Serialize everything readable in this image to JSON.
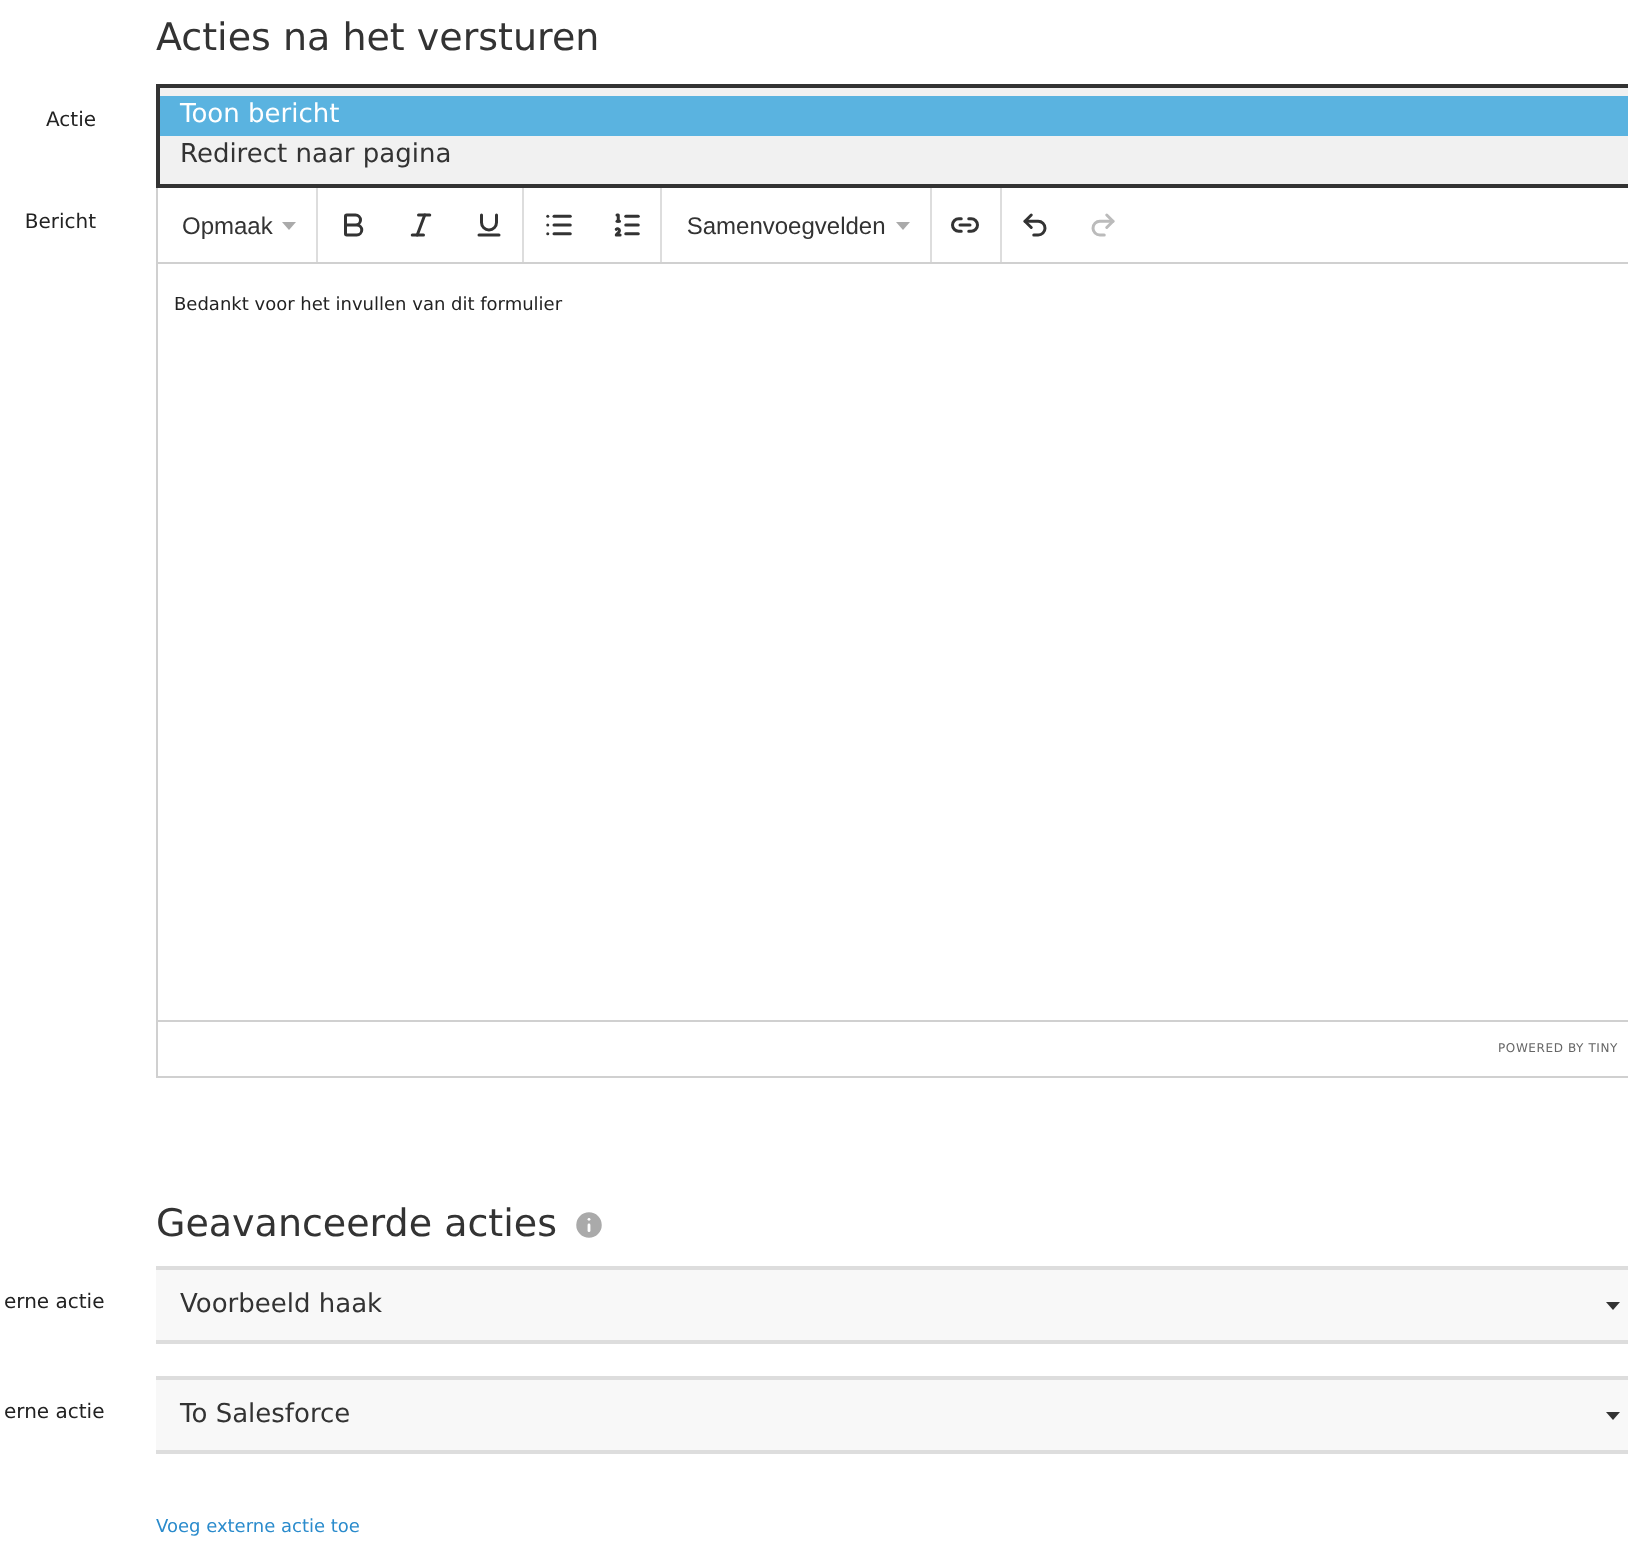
{
  "section_title": "Acties na het versturen",
  "action_field": {
    "label": "Actie",
    "options": [
      {
        "label": "Toon bericht",
        "selected": true
      },
      {
        "label": "Redirect naar pagina",
        "selected": false
      }
    ]
  },
  "message_field": {
    "label": "Bericht",
    "toolbar": [
      {
        "kind": "dropdown",
        "label": "Opmaak"
      },
      {
        "kind": "separator"
      },
      {
        "kind": "bold",
        "disabled": false
      },
      {
        "kind": "italic",
        "disabled": false
      },
      {
        "kind": "underline",
        "disabled": false
      },
      {
        "kind": "separator"
      },
      {
        "kind": "bullets",
        "disabled": false
      },
      {
        "kind": "numbering",
        "disabled": false
      },
      {
        "kind": "separator"
      },
      {
        "kind": "dropdown",
        "label": "Samenvoegvelden"
      },
      {
        "kind": "separator"
      },
      {
        "kind": "link",
        "disabled": false
      },
      {
        "kind": "separator"
      },
      {
        "kind": "undo",
        "disabled": false
      },
      {
        "kind": "redo",
        "disabled": true
      }
    ],
    "content": "Bedankt voor het invullen van dit formulier",
    "branding": "POWERED BY TINY"
  },
  "advanced_title": "Geavanceerde acties",
  "external_actions": [
    {
      "label": "erne actie",
      "value": "Voorbeeld haak"
    },
    {
      "label": "erne actie",
      "value": "To Salesforce"
    }
  ],
  "add_link": "Voeg externe actie toe"
}
